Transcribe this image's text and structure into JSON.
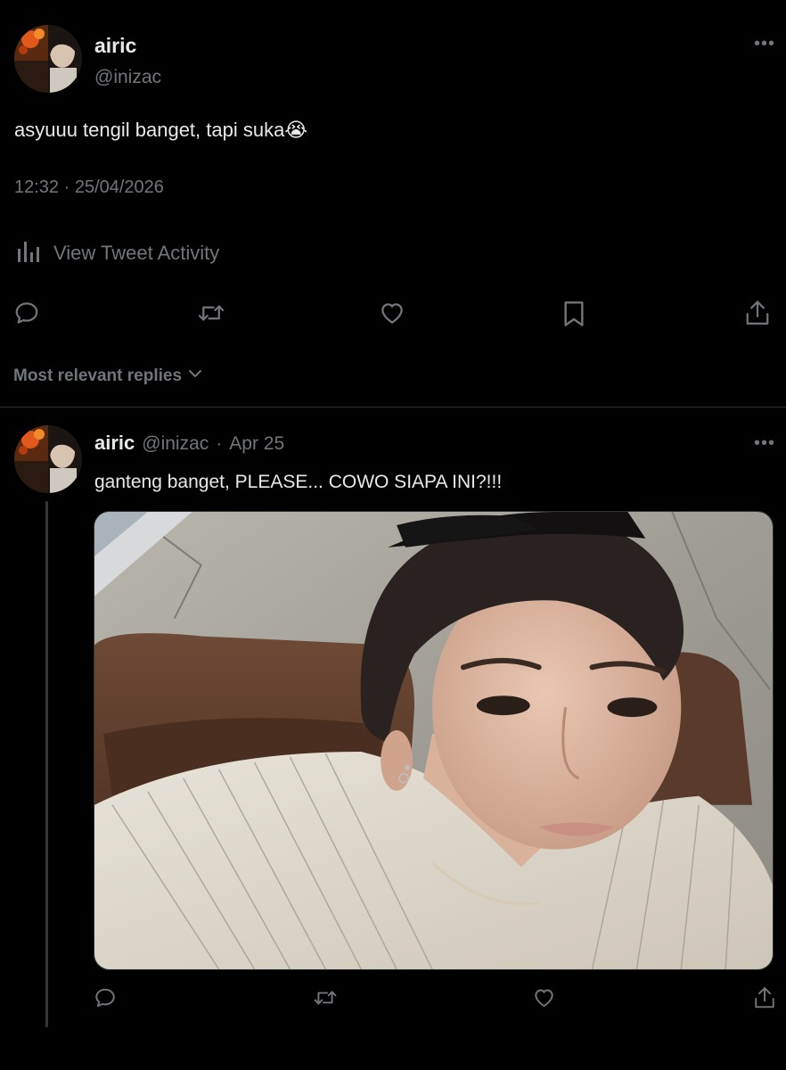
{
  "main_tweet": {
    "author_name": "airic",
    "author_handle": "@inizac",
    "more_icon": "ellipsis-icon",
    "text": "asyuuu tengil banget, tapi suka",
    "emoji": "😭",
    "timestamp": "12:32 · 25/04/2026",
    "activity_label": "View Tweet Activity",
    "actions": [
      "reply-icon",
      "retweet-icon",
      "like-icon",
      "bookmark-icon",
      "share-icon"
    ]
  },
  "replies_sort": {
    "label": "Most relevant replies",
    "icon": "chevron-down-icon"
  },
  "reply_tweet": {
    "author_name": "airic",
    "author_handle": "@inizac",
    "separator": "·",
    "date": "Apr 25",
    "text": "ganteng banget, PLEASE... COWO SIAPA INI?!!!",
    "media_alt": "photo",
    "actions": [
      "reply-icon",
      "retweet-icon",
      "like-icon",
      "share-icon"
    ]
  },
  "colors": {
    "background": "#000000",
    "text_primary": "#e7e9ea",
    "text_secondary": "#71767b",
    "divider": "#2f3336"
  }
}
